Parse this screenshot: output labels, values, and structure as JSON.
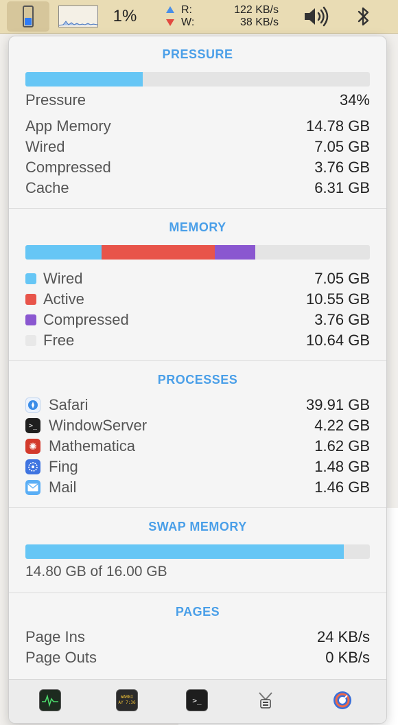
{
  "menubar": {
    "cpu_percent": "1%",
    "net": {
      "read_label": "R:",
      "write_label": "W:",
      "read_value": "122 KB/s",
      "write_value": "38 KB/s"
    }
  },
  "pressure": {
    "title": "PRESSURE",
    "fill_percent": 34,
    "label": "Pressure",
    "value": "34%",
    "rows": [
      {
        "label": "App Memory",
        "value": "14.78 GB"
      },
      {
        "label": "Wired",
        "value": "7.05 GB"
      },
      {
        "label": "Compressed",
        "value": "3.76 GB"
      },
      {
        "label": "Cache",
        "value": "6.31 GB"
      }
    ]
  },
  "memory": {
    "title": "MEMORY",
    "segments": [
      {
        "name": "Wired",
        "gb": 7.05,
        "color": "#66c6f5"
      },
      {
        "name": "Active",
        "gb": 10.55,
        "color": "#e8544a"
      },
      {
        "name": "Compressed",
        "gb": 3.76,
        "color": "#8a57d0"
      },
      {
        "name": "Free",
        "gb": 10.64,
        "color": "#e4e4e4"
      }
    ],
    "rows": [
      {
        "label": "Wired",
        "value": "7.05 GB",
        "color": "#66c6f5"
      },
      {
        "label": "Active",
        "value": "10.55 GB",
        "color": "#e8544a"
      },
      {
        "label": "Compressed",
        "value": "3.76 GB",
        "color": "#8a57d0"
      },
      {
        "label": "Free",
        "value": "10.64 GB",
        "color": "#e8e8e8"
      }
    ]
  },
  "processes": {
    "title": "PROCESSES",
    "rows": [
      {
        "label": "Safari",
        "value": "39.91 GB",
        "icon": "safari-icon",
        "color": "#3b8de8"
      },
      {
        "label": "WindowServer",
        "value": "4.22 GB",
        "icon": "terminal-icon",
        "color": "#1e1e1e"
      },
      {
        "label": "Mathematica",
        "value": "1.62 GB",
        "icon": "mathematica-icon",
        "color": "#d33a2c"
      },
      {
        "label": "Fing",
        "value": "1.48 GB",
        "icon": "fing-icon",
        "color": "#3f74e0"
      },
      {
        "label": "Mail",
        "value": "1.46 GB",
        "icon": "mail-icon",
        "color": "#5aaef5"
      }
    ]
  },
  "swap": {
    "title": "SWAP MEMORY",
    "used_gb": 14.8,
    "total_gb": 16.0,
    "text": "14.80 GB of 16.00 GB"
  },
  "pages": {
    "title": "PAGES",
    "rows": [
      {
        "label": "Page Ins",
        "value": "24 KB/s"
      },
      {
        "label": "Page Outs",
        "value": "0 KB/s"
      }
    ]
  },
  "toolbar": {
    "buttons": [
      "activity-monitor-icon",
      "console-icon",
      "terminal-icon",
      "system-information-icon",
      "istat-icon"
    ],
    "console_text": "WARNI\nAY 7:36"
  },
  "colors": {
    "accent": "#4a9fe8",
    "swap_fill": "#66c6f5"
  }
}
